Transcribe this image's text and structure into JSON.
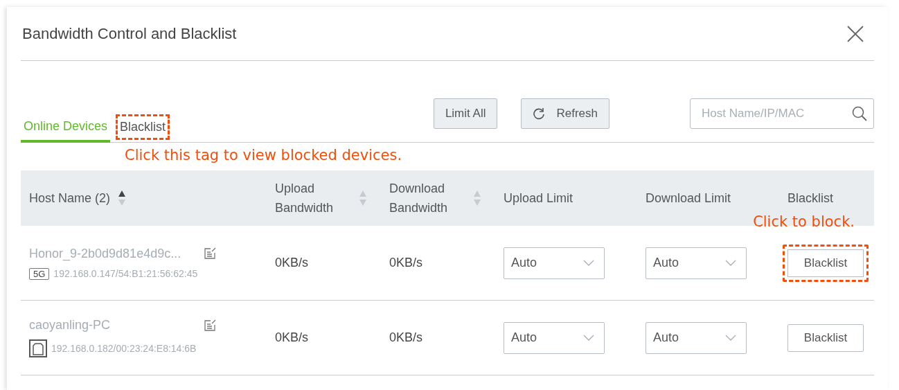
{
  "dialog": {
    "title": "Bandwidth Control and Blacklist"
  },
  "tabs": [
    {
      "label": "Online Devices",
      "selected": true,
      "highlighted": false
    },
    {
      "label": "Blacklist",
      "selected": false,
      "highlighted": true
    }
  ],
  "tab_note": "Click this tag to view blocked devices.",
  "toolbar": {
    "buttons": [
      {
        "kind": "plain",
        "label": "Limit All"
      },
      {
        "kind": "refresh",
        "label": "Refresh"
      }
    ],
    "search": {
      "placeholder": "Host Name/IP/MAC"
    }
  },
  "table": {
    "columns": [
      {
        "label": "Host Name (2)",
        "sortable": true,
        "sorted_ascending": true
      },
      {
        "label": "Upload Bandwidth",
        "sortable": true,
        "sorted_ascending": false
      },
      {
        "label": "Download Bandwidth",
        "sortable": true,
        "sorted_ascending": false
      },
      {
        "label": "Upload Limit"
      },
      {
        "label": "Download Limit"
      },
      {
        "label": "Blacklist"
      }
    ],
    "rows": [
      {
        "host": "Honor_9-2b0d9d81e4d9c...",
        "connection": {
          "kind": "badge",
          "label": "5G"
        },
        "address": "192.168.0.147/54:B1:21:56:62:45",
        "upload": "0KB/s",
        "download": "0KB/s",
        "upload_limit": "Auto",
        "download_limit": "Auto",
        "action": {
          "label": "Blacklist",
          "highlighted": true,
          "note": "Click to block."
        }
      },
      {
        "host": "caoyanling-PC",
        "connection": {
          "kind": "wired"
        },
        "address": "192.168.0.182/00:23:24:E8:14:6B",
        "upload": "0KB/s",
        "download": "0KB/s",
        "upload_limit": "Auto",
        "download_limit": "Auto",
        "action": {
          "label": "Blacklist",
          "highlighted": false
        }
      }
    ]
  }
}
